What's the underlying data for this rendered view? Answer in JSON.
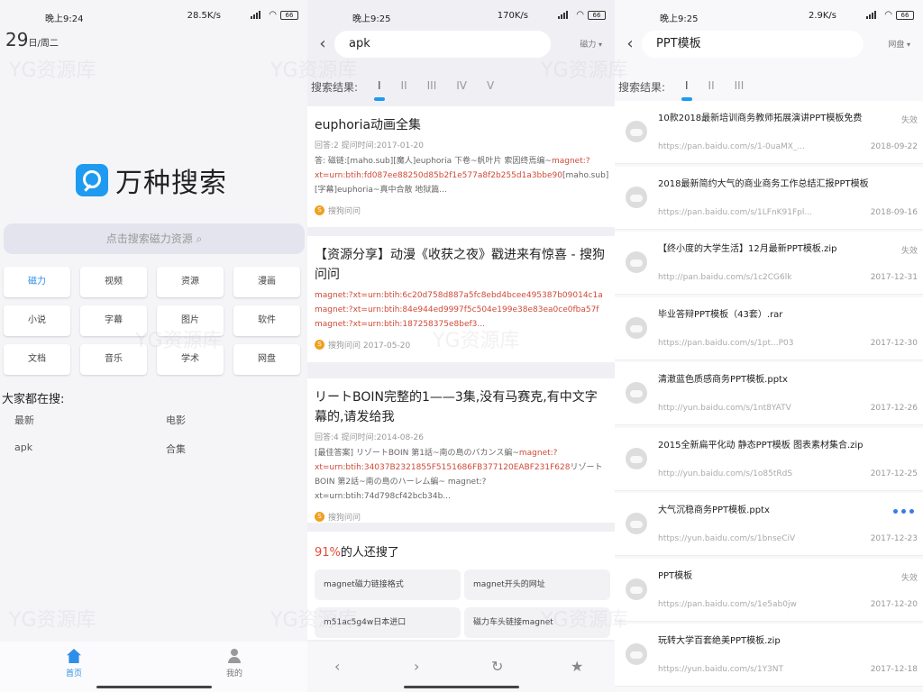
{
  "phone1": {
    "status": {
      "time": "晚上9:24",
      "speed": "28.5K/s",
      "battery": "66"
    },
    "date_day": "29",
    "date_week": "日/周二",
    "app_name": "万种搜索",
    "search_placeholder": "点击搜索磁力资源",
    "categories": [
      "磁力",
      "视频",
      "资源",
      "漫画",
      "小说",
      "字幕",
      "图片",
      "软件",
      "文档",
      "音乐",
      "学术",
      "网盘"
    ],
    "active_category": 0,
    "hot_title": "大家都在搜:",
    "hot_items": [
      "最新",
      "电影",
      "apk",
      "合集"
    ],
    "tabs": [
      "首页",
      "我的"
    ]
  },
  "phone2": {
    "status": {
      "time": "晚上9:25",
      "speed": "170K/s",
      "battery": "66"
    },
    "query": "apk",
    "scope": "磁力",
    "results_label": "搜索结果:",
    "pages": [
      "I",
      "II",
      "III",
      "IV",
      "V"
    ],
    "cards": [
      {
        "title": "euphoria动画全集",
        "meta": "回答:2  提问时间:2017-01-20",
        "body_a": "答:  磁链:[maho.sub][魔人]euphoria 下卷~帆叶片 索因终焉编~",
        "body_mag": "magnet:?xt=urn:btih:fd087ee88250d85b2f1e577a8f2b255d1a3bbe90",
        "body_b": "[maho.sub][字幕]euphoria~真中合散 地狱篇...",
        "source": "搜狗问问"
      },
      {
        "title": "【资源分享】动漫《收获之夜》戳进来有惊喜 - 搜狗问问",
        "meta": "",
        "body_a": "",
        "body_mag": "magnet:?xt=urn:btih:6c20d758d887a5fc8ebd4bcee495387b09014c1a magnet:?xt=urn:btih:84e944ed9997f5c504e199e38e83ea0ce0fba57f magnet:?xt=urn:btih:187258375e8bef3...",
        "body_b": "",
        "source": "搜狗问问  2017-05-20"
      },
      {
        "title": "リートBOIN完整的1——3集,没有马赛克,有中文字幕的,请发给我",
        "meta": "回答:4  提问时间:2014-08-26",
        "body_a": "[最佳答案] リゾートBOIN 第1話~南の島のバカンス編~",
        "body_mag": "magnet:?xt=urn:btih:34037B2321855F5151686FB377120EABF231F628",
        "body_b": "リゾートBOIN 第2話~南の島のハーレム編~ magnet:?xt=urn:btih:74d798cf42bcb34b...",
        "source": "搜狗问问"
      }
    ],
    "also_pct": "91%",
    "also_text": "的人还搜了",
    "also_chips": [
      "magnet磁力链接格式",
      "magnet开头的网址",
      "m51ac5g4w日本进口",
      "磁力车头链接magnet"
    ],
    "nav": [
      "‹",
      "›",
      "↻",
      "★"
    ]
  },
  "phone3": {
    "status": {
      "time": "晚上9:25",
      "speed": "2.9K/s",
      "battery": "66"
    },
    "query": "PPT模板",
    "scope": "网盘",
    "results_label": "搜索结果:",
    "pages": [
      "I",
      "II",
      "III"
    ],
    "rows": [
      {
        "title": "10款2018最新培训商务教师拓展演讲PPT模板免费",
        "status": "失效",
        "url": "https://pan.baidu.com/s/1-0uaMX_...",
        "date": "2018-09-22"
      },
      {
        "title": "2018最新简约大气的商业商务工作总结汇报PPT模板",
        "status": "",
        "url": "https://pan.baidu.com/s/1LFnK91Fpl...",
        "date": "2018-09-16"
      },
      {
        "title": "【终小度的大学生活】12月最新PPT模板.zip",
        "status": "失效",
        "url": "http://pan.baidu.com/s/1c2CG6lk",
        "date": "2017-12-31"
      },
      {
        "title": "毕业答辩PPT模板（43套）.rar",
        "status": "",
        "url": "https://pan.baidu.com/s/1pt...P03",
        "date": "2017-12-30"
      },
      {
        "title": "清澈蓝色质感商务PPT模板.pptx",
        "status": "",
        "url": "http://yun.baidu.com/s/1nt8YATV",
        "date": "2017-12-26"
      },
      {
        "title": "2015全新扁平化动 静态PPT模板 图表素材集合.zip",
        "status": "",
        "url": "http://yun.baidu.com/s/1o85tRdS",
        "date": "2017-12-25"
      },
      {
        "title": "大气沉稳商务PPT模板.pptx",
        "status": "loading",
        "url": "https://yun.baidu.com/s/1bnseCiV",
        "date": "2017-12-23"
      },
      {
        "title": "PPT模板",
        "status": "失效",
        "url": "https://pan.baidu.com/s/1e5ab0jw",
        "date": "2017-12-20"
      },
      {
        "title": "玩转大学百套绝美PPT模板.zip",
        "status": "",
        "url": "https://yun.baidu.com/s/1Y3NT",
        "date": "2017-12-18"
      }
    ]
  },
  "watermark": "YG资源库"
}
